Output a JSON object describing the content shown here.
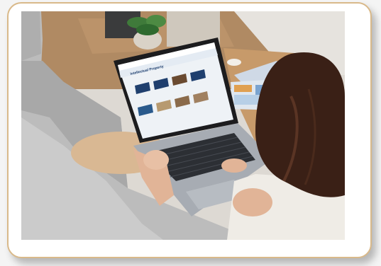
{
  "screen": {
    "page_heading": "Intellectual Property"
  },
  "colors": {
    "frame_border": "#d9b98a",
    "wall": "#ddd9d3",
    "floor_wood": "#b08a63",
    "couch": "#bcbcbc",
    "laptop_body": "#9aa0a8",
    "keyboard": "#2c2f34",
    "hair": "#3a2016",
    "shirt": "#efece6",
    "skin": "#e1b497",
    "card_blue": "#1f3f6e"
  }
}
